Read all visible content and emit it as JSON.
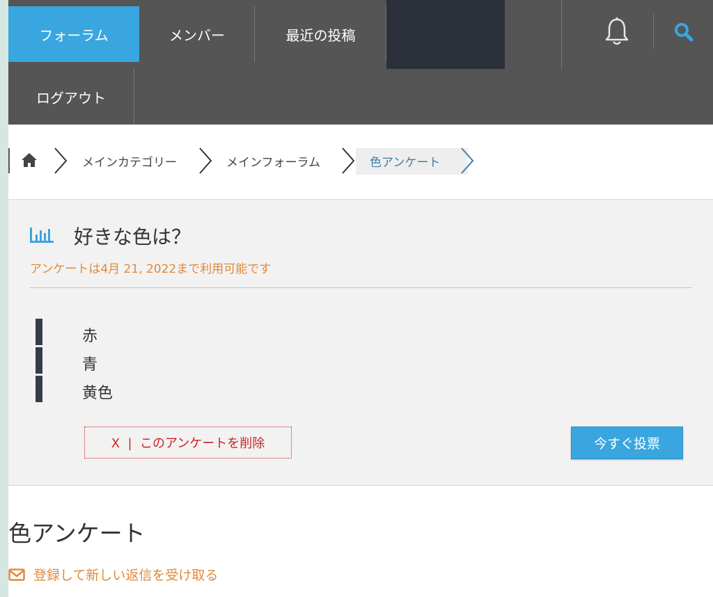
{
  "nav": {
    "forum": "フォーラム",
    "members": "メンバー",
    "recent_posts": "最近の投稿",
    "logout": "ログアウト",
    "notifications_icon": "bell-icon",
    "search_icon": "search-icon"
  },
  "breadcrumb": {
    "home_icon": "home-icon",
    "items": [
      "メインカテゴリー",
      "メインフォーラム",
      "色アンケート"
    ]
  },
  "poll": {
    "title": "好きな色は？",
    "expiry": "アンケートは4月 21, 2022まで利用可能です",
    "options": [
      "赤",
      "青",
      "黄色"
    ],
    "delete_label": "X  |  このアンケートを削除",
    "vote_label": "今すぐ投票"
  },
  "topic": {
    "title": "色アンケート",
    "subscribe_label": "登録して新しい返信を受け取る"
  },
  "colors": {
    "accent": "#3aa6e0",
    "nav_bg": "#555555",
    "orange": "#e08a3a",
    "delete_red": "#cc2222"
  }
}
